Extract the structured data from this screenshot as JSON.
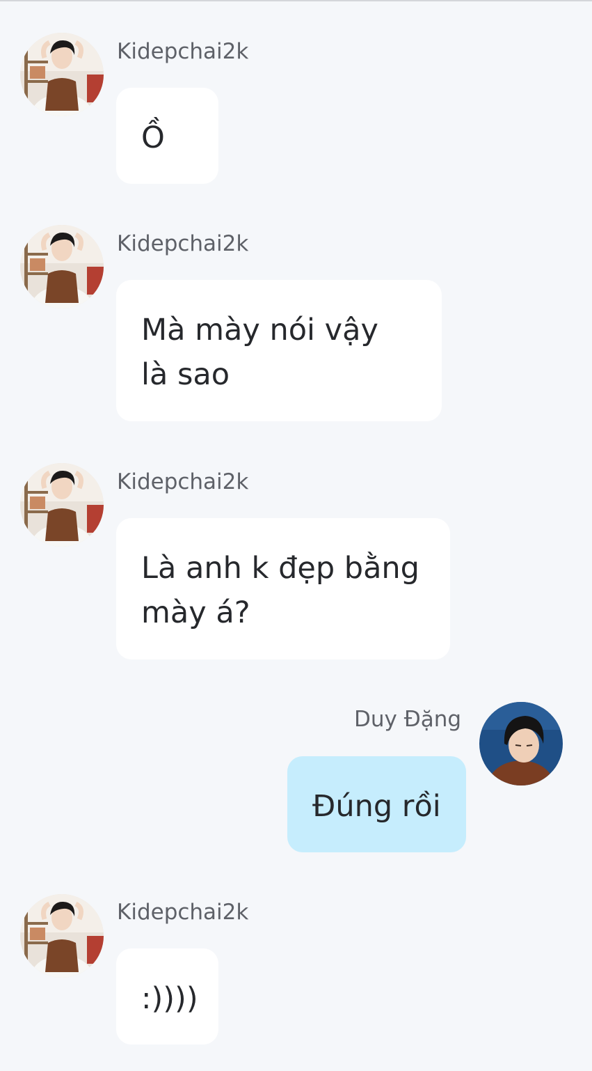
{
  "conversation": {
    "messages": [
      {
        "sender": "Kidepchai2k",
        "text": "Ồ",
        "side": "left",
        "avatar": "avatar-kidepchai2k"
      },
      {
        "sender": "Kidepchai2k",
        "text": "Mà mày nói vậy\nlà sao",
        "side": "left",
        "avatar": "avatar-kidepchai2k"
      },
      {
        "sender": "Kidepchai2k",
        "text": "Là anh k đẹp bằng\nmày á?",
        "side": "left",
        "avatar": "avatar-kidepchai2k"
      },
      {
        "sender": "Duy Đặng",
        "text": "Đúng rồi",
        "side": "right",
        "avatar": "avatar-duy-dang"
      },
      {
        "sender": "Kidepchai2k",
        "text": ":))))",
        "side": "left",
        "avatar": "avatar-kidepchai2k"
      }
    ]
  },
  "colors": {
    "background": "#f5f7fa",
    "incoming_bubble": "#ffffff",
    "outgoing_bubble": "#c6edfd",
    "sender_name": "#5e6168",
    "message_text": "#26282c"
  }
}
